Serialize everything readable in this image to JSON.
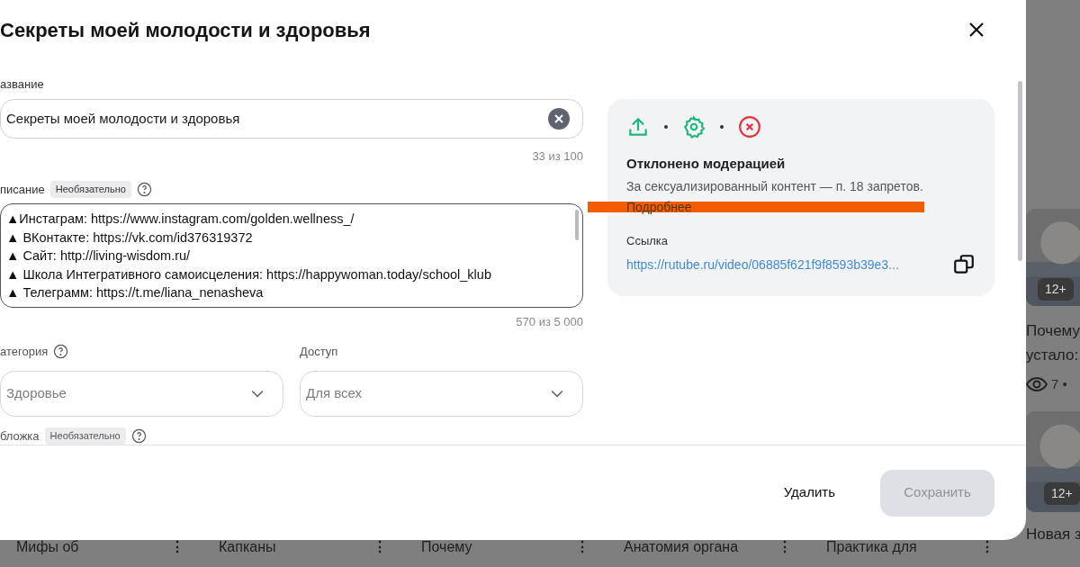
{
  "modal": {
    "title": "Секреты моей молодости и здоровья",
    "name_field": {
      "label": "азвание",
      "value": "Секреты моей молодости и здоровья",
      "counter": "33 из 100"
    },
    "description_field": {
      "label": "писание",
      "badge": "Необязательно",
      "lines": [
        "▲Инстаграм: https://www.instagram.com/golden.wellness_/",
        "▲ ВКонтакте: https://vk.com/id376319372",
        "▲ Сайт: http://living-wisdom.ru/",
        "▲ Школа Интегративного самоисцеления: https://happywoman.today/school_klub",
        "▲ Телеграмм: https://t.me/liana_nenasheva"
      ],
      "counter": "570 из 5 000"
    },
    "selects": [
      {
        "label": "атегория",
        "help": true,
        "value": "Здоровье"
      },
      {
        "label": "Доступ",
        "help": false,
        "value": "Для всех"
      }
    ],
    "cover_field": {
      "label": "бложка",
      "badge": "Необязательно"
    },
    "status_card": {
      "steps": [
        {
          "kind": "upload",
          "color": "#1fb57c"
        },
        {
          "kind": "settings",
          "color": "#1fb57c"
        },
        {
          "kind": "rejected",
          "color": "#e5333f"
        }
      ],
      "title": "Отклонено модерацией",
      "reason": "За сексуализированный контент — п. 18 запретов.",
      "more_link": "Подробнее",
      "link_label": "Ссылка",
      "link": "https://rutube.ru/video/06885f621f9f8593b39e3..."
    },
    "buttons": [
      {
        "label": "Удалить",
        "disabled": false
      },
      {
        "label": "Сохранить",
        "disabled": true
      }
    ]
  },
  "background": {
    "side_card": {
      "badge": "12+",
      "title_lines": [
        "Почему",
        "устало:"
      ],
      "views": "7 •"
    },
    "side_card_2": {
      "badge": "12+",
      "title": "Новая з"
    },
    "bottom_cards": [
      {
        "title": "Мифы об",
        "menu": "⋮"
      },
      {
        "title": "Капканы",
        "menu": "⋮"
      },
      {
        "title": "Почему",
        "menu": "⋮"
      },
      {
        "title": "Анатомия органа",
        "menu": "⋮"
      },
      {
        "title": "Практика для",
        "menu": "⋮"
      }
    ]
  }
}
